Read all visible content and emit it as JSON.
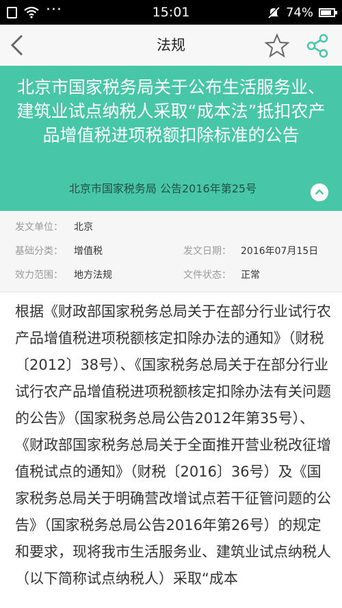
{
  "status_bar": {
    "time": "15:01",
    "battery": "74%",
    "dots": "···",
    "icons": [
      "sim-icon",
      "wifi-icon",
      "mute-icon",
      "battery-icon"
    ]
  },
  "nav": {
    "title": "法规",
    "icons": [
      "back-icon",
      "star-icon",
      "share-icon"
    ],
    "accent_color": "#47c7a8"
  },
  "banner": {
    "title": "北京市国家税务局关于公布生活服务业、建筑业试点纳税人采取“成本法”抵扣农产品增值税进项税额扣除标准的公告",
    "subtitle": "北京市国家税务局 公告2016年第25号",
    "background": "#47c7a8"
  },
  "meta": {
    "issuer_label": "发文单位：",
    "issuer": "北京",
    "category_label": "基础分类：",
    "category": "增值税",
    "date_label": "发文日期：",
    "date": "2016年07月15日",
    "scope_label": "效力范围：",
    "scope": "地方法规",
    "status_label": "文件状态：",
    "status": "正常"
  },
  "body": {
    "text": "根据《财政部国家税务总局关于在部分行业试行农产品增值税进项税额核定扣除办法的通知》（财税〔2012〕38号）、《国家税务总局关于在部分行业试行农产品增值税进项税额核定扣除办法有关问题的公告》（国家税务总局公告2012年第35号）、《财政部国家税务总局关于全面推开营业税改征增值税试点的通知》（财税〔2016〕36号）及《国家税务总局关于明确营改增试点若干征管问题的公告》（国家税务总局公告2016年第26号）的规定和要求，现将我市生活服务业、建筑业试点纳税人（以下简称试点纳税人）采取“成本"
  }
}
